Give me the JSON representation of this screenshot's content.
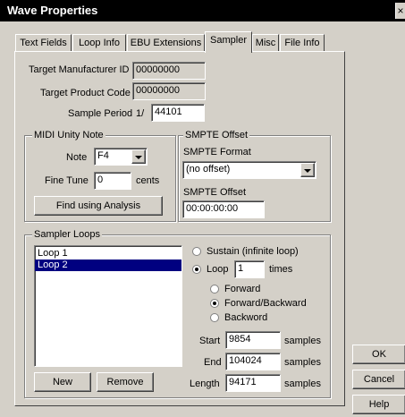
{
  "window": {
    "title": "Wave Properties",
    "close": "×"
  },
  "tabs": [
    {
      "label": "Text Fields"
    },
    {
      "label": "Loop Info"
    },
    {
      "label": "EBU Extensions"
    },
    {
      "label": "Sampler",
      "active": true
    },
    {
      "label": "Misc"
    },
    {
      "label": "File Info"
    }
  ],
  "target": {
    "manufacturer_label": "Target Manufacturer ID",
    "manufacturer_value": "00000000",
    "product_label": "Target Product Code",
    "product_value": "00000000",
    "period_label": "Sample Period",
    "period_prefix": "1/",
    "period_value": "44101"
  },
  "midi": {
    "group_title": "MIDI Unity Note",
    "note_label": "Note",
    "note_value": "F4",
    "finetune_label": "Fine Tune",
    "finetune_value": "0",
    "finetune_unit": "cents",
    "analysis_button": "Find using Analysis"
  },
  "smpte": {
    "group_title": "SMPTE Offset",
    "format_label": "SMPTE Format",
    "format_value": "(no offset)",
    "offset_label": "SMPTE Offset",
    "offset_value": "00:00:00:00"
  },
  "loops": {
    "group_title": "Sampler Loops",
    "items": [
      "Loop 1",
      "Loop 2"
    ],
    "selected_index": 1,
    "sustain_label": "Sustain (infinite loop)",
    "loop_label": "Loop",
    "loop_times_value": "1",
    "times_label": "times",
    "forward_label": "Forward",
    "fwdbwd_label": "Forward/Backward",
    "backward_label": "Backword",
    "start_label": "Start",
    "start_value": "9854",
    "end_label": "End",
    "end_value": "104024",
    "length_label": "Length",
    "length_value": "94171",
    "samples_label": "samples",
    "new_button": "New",
    "remove_button": "Remove"
  },
  "dialog": {
    "ok": "OK",
    "cancel": "Cancel",
    "help": "Help"
  },
  "colors": {
    "titlebar": "#000000",
    "face": "#d4d0c8",
    "selection": "#000080"
  }
}
